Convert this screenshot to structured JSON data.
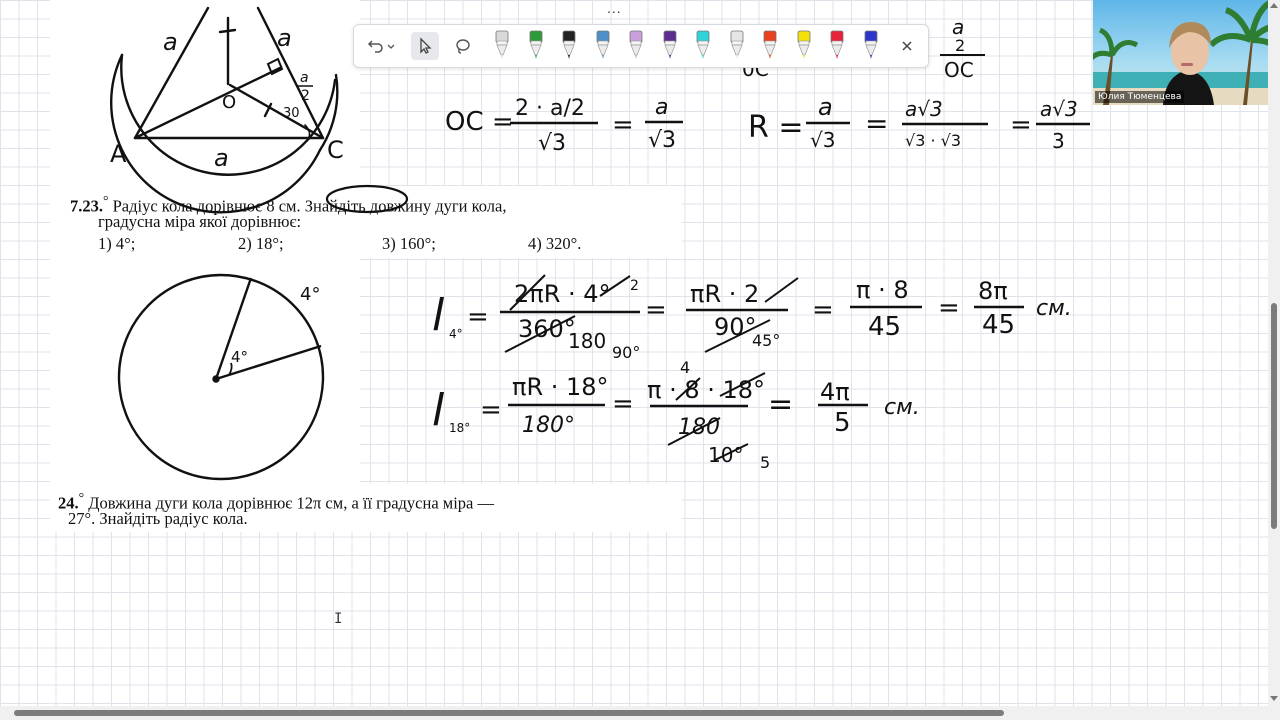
{
  "toolbar": {
    "tools": [
      "undo-icon",
      "dropdown-icon",
      "pointer-icon",
      "lasso-icon"
    ],
    "pen_colors": [
      "#d9d9d9",
      "#2e9b3a",
      "#222222",
      "#4f8fc7",
      "#c9a0dc",
      "#5b2d8e",
      "#2fd3d8",
      "#e6e6e6",
      "#e8421f",
      "#f5e10a",
      "#e5223a",
      "#2b37c9"
    ],
    "close_icon": "close-icon",
    "more_label": "..."
  },
  "problem_723": {
    "number": "7.23.",
    "degree_mark": "°",
    "line1": "Радіус кола дорівнює 8 см. Знайдіть довжину дуги кола,",
    "line2": "градусна міра якої дорівнює:",
    "options": [
      "1) 4°;",
      "2) 18°;",
      "3) 160°;",
      "4) 320°."
    ]
  },
  "problem_24": {
    "number": "24.",
    "degree_mark": "°",
    "line1": "Довжина дуги кола дорівнює 12π см, а її градусна міра —",
    "line2": "27°. Знайдіть радіус кола."
  },
  "handwriting": {
    "top_fig_labels": [
      "a",
      "a",
      "a",
      "A",
      "C",
      "O",
      "30"
    ],
    "oc_eq": [
      "OC =",
      "2 · a/2",
      "√3",
      "=",
      "a",
      "√3"
    ],
    "r_eq": [
      "R =",
      "a",
      "√3",
      "=",
      "a√3",
      "√3 · √3",
      "=",
      "a√3",
      "3"
    ],
    "top_right_frac": [
      "a",
      "2",
      "OC"
    ],
    "arc_label": "4°",
    "center_label": "4°",
    "l4": {
      "lhs": "l",
      "sub": "4°",
      "n1": "2πR · 4°",
      "d1": "360°",
      "d1b": "180",
      "d1c": "90°",
      "n1b": "2",
      "n2": "πR · 2",
      "d2": "90°",
      "d2b": "45°",
      "n3": "π · 8",
      "d3": "45",
      "n4": "8π",
      "d4": "45",
      "unit": "см."
    },
    "l18": {
      "lhs": "l",
      "sub": "18°",
      "n1": "πR · 18°",
      "d1": "180°",
      "n2": "π · 8 · 18°",
      "n2top": "4",
      "d2": "180",
      "d2b": "10°",
      "d2c": "5",
      "n3": "4π",
      "d3": "5",
      "unit": "см."
    }
  },
  "webcam": {
    "name": "Юлия Тюменцева"
  }
}
